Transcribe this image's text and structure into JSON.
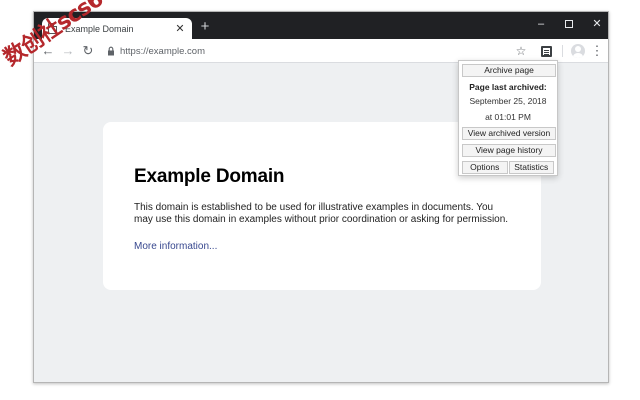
{
  "window": {
    "tab_title": "Example Domain",
    "tab_close": "✕",
    "new_tab": "+",
    "minimize": "–",
    "close": "✕"
  },
  "toolbar": {
    "back": "←",
    "forward": "→",
    "reload": "↻",
    "url": "https://example.com",
    "star": "☆",
    "menu": "⋮"
  },
  "page": {
    "heading": "Example Domain",
    "paragraph": "This domain is established to be used for illustrative examples in documents. You may use this domain in examples without prior coordination or asking for permission.",
    "link": "More information..."
  },
  "popup": {
    "archive_button": "Archive page",
    "last_archived_label": "Page last archived:",
    "date": "September 25, 2018",
    "time": "at 01:01 PM",
    "view_archived_button": "View archived version",
    "history_button": "View page history",
    "options_button": "Options",
    "statistics_button": "Statistics"
  },
  "watermark": "数创社scs66",
  "icons": {
    "tab_favicon": "page-icon",
    "lock": "lock-icon",
    "extension": "archive-extension-icon",
    "profile": "avatar-icon"
  },
  "colors": {
    "titlebar": "#202124",
    "page_background": "#eef0f2",
    "link": "#38488f",
    "watermark": "#b5282c"
  }
}
